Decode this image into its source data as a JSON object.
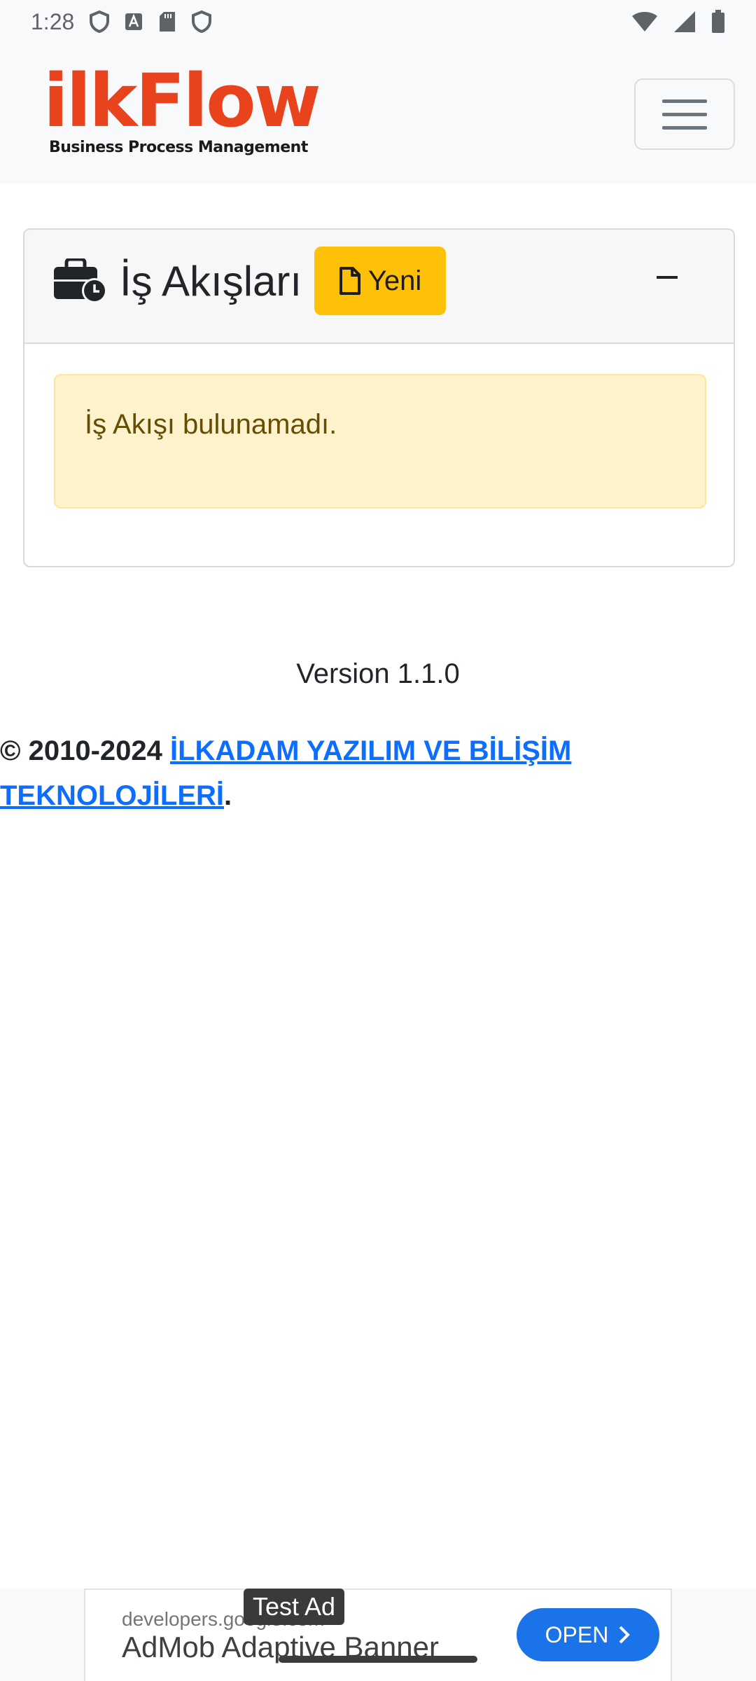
{
  "status_bar": {
    "time": "1:28"
  },
  "navbar": {
    "brand_name": "ilkFlow",
    "brand_tagline": "Business Process Management"
  },
  "card": {
    "title": "İş Akışları",
    "new_button_label": "Yeni",
    "empty_message": "İş Akışı bulunamadı."
  },
  "footer": {
    "version": "Version 1.1.0",
    "copyright_prefix": "© 2010-2024 ",
    "company_link": "İLKADAM YAZILIM VE BİLİŞİM TEKNOLOJİLERİ",
    "copyright_suffix": "."
  },
  "ad": {
    "badge": "Test Ad",
    "domain": "developers.google.com",
    "title": "AdMob Adaptive Banner",
    "open_label": "OPEN"
  },
  "colors": {
    "brand": "#e8431c",
    "warning": "#ffc107",
    "link": "#0d6efd",
    "ad_button": "#1a73e8"
  }
}
